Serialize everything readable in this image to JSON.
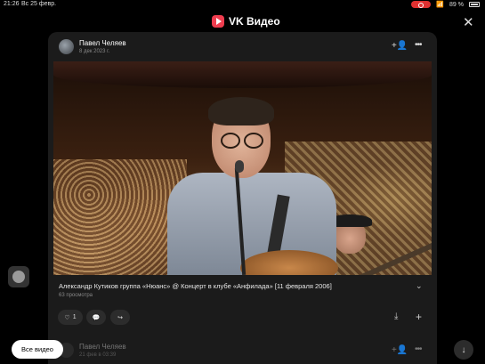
{
  "status_bar": {
    "time": "21:26",
    "date": "Вс 25 февр.",
    "battery": "89 %"
  },
  "header": {
    "title": "VK Видео"
  },
  "post": {
    "author": "Павел Челяев",
    "date": "8 дек 2023 г.",
    "video_title": "Александр Кутиков группа «Нюанс» @ Концерт в клубе «Анфилада» [11 февраля 2006]",
    "views": "63 просмотра",
    "likes": "1"
  },
  "next_post": {
    "author": "Павел Челяев",
    "date": "21 фев в 03:39"
  },
  "buttons": {
    "all_videos": "Все видео"
  },
  "icons": {
    "close": "✕",
    "add_friend": "+👤",
    "more": "•••",
    "chevron": "⌄",
    "heart": "♡",
    "comment": "💬",
    "share": "↪",
    "download": "⤓",
    "add": "+",
    "arrow_down": "↓"
  },
  "colors": {
    "accent": "#ef3d4f",
    "background": "#000000",
    "card": "#1b1b1b"
  }
}
